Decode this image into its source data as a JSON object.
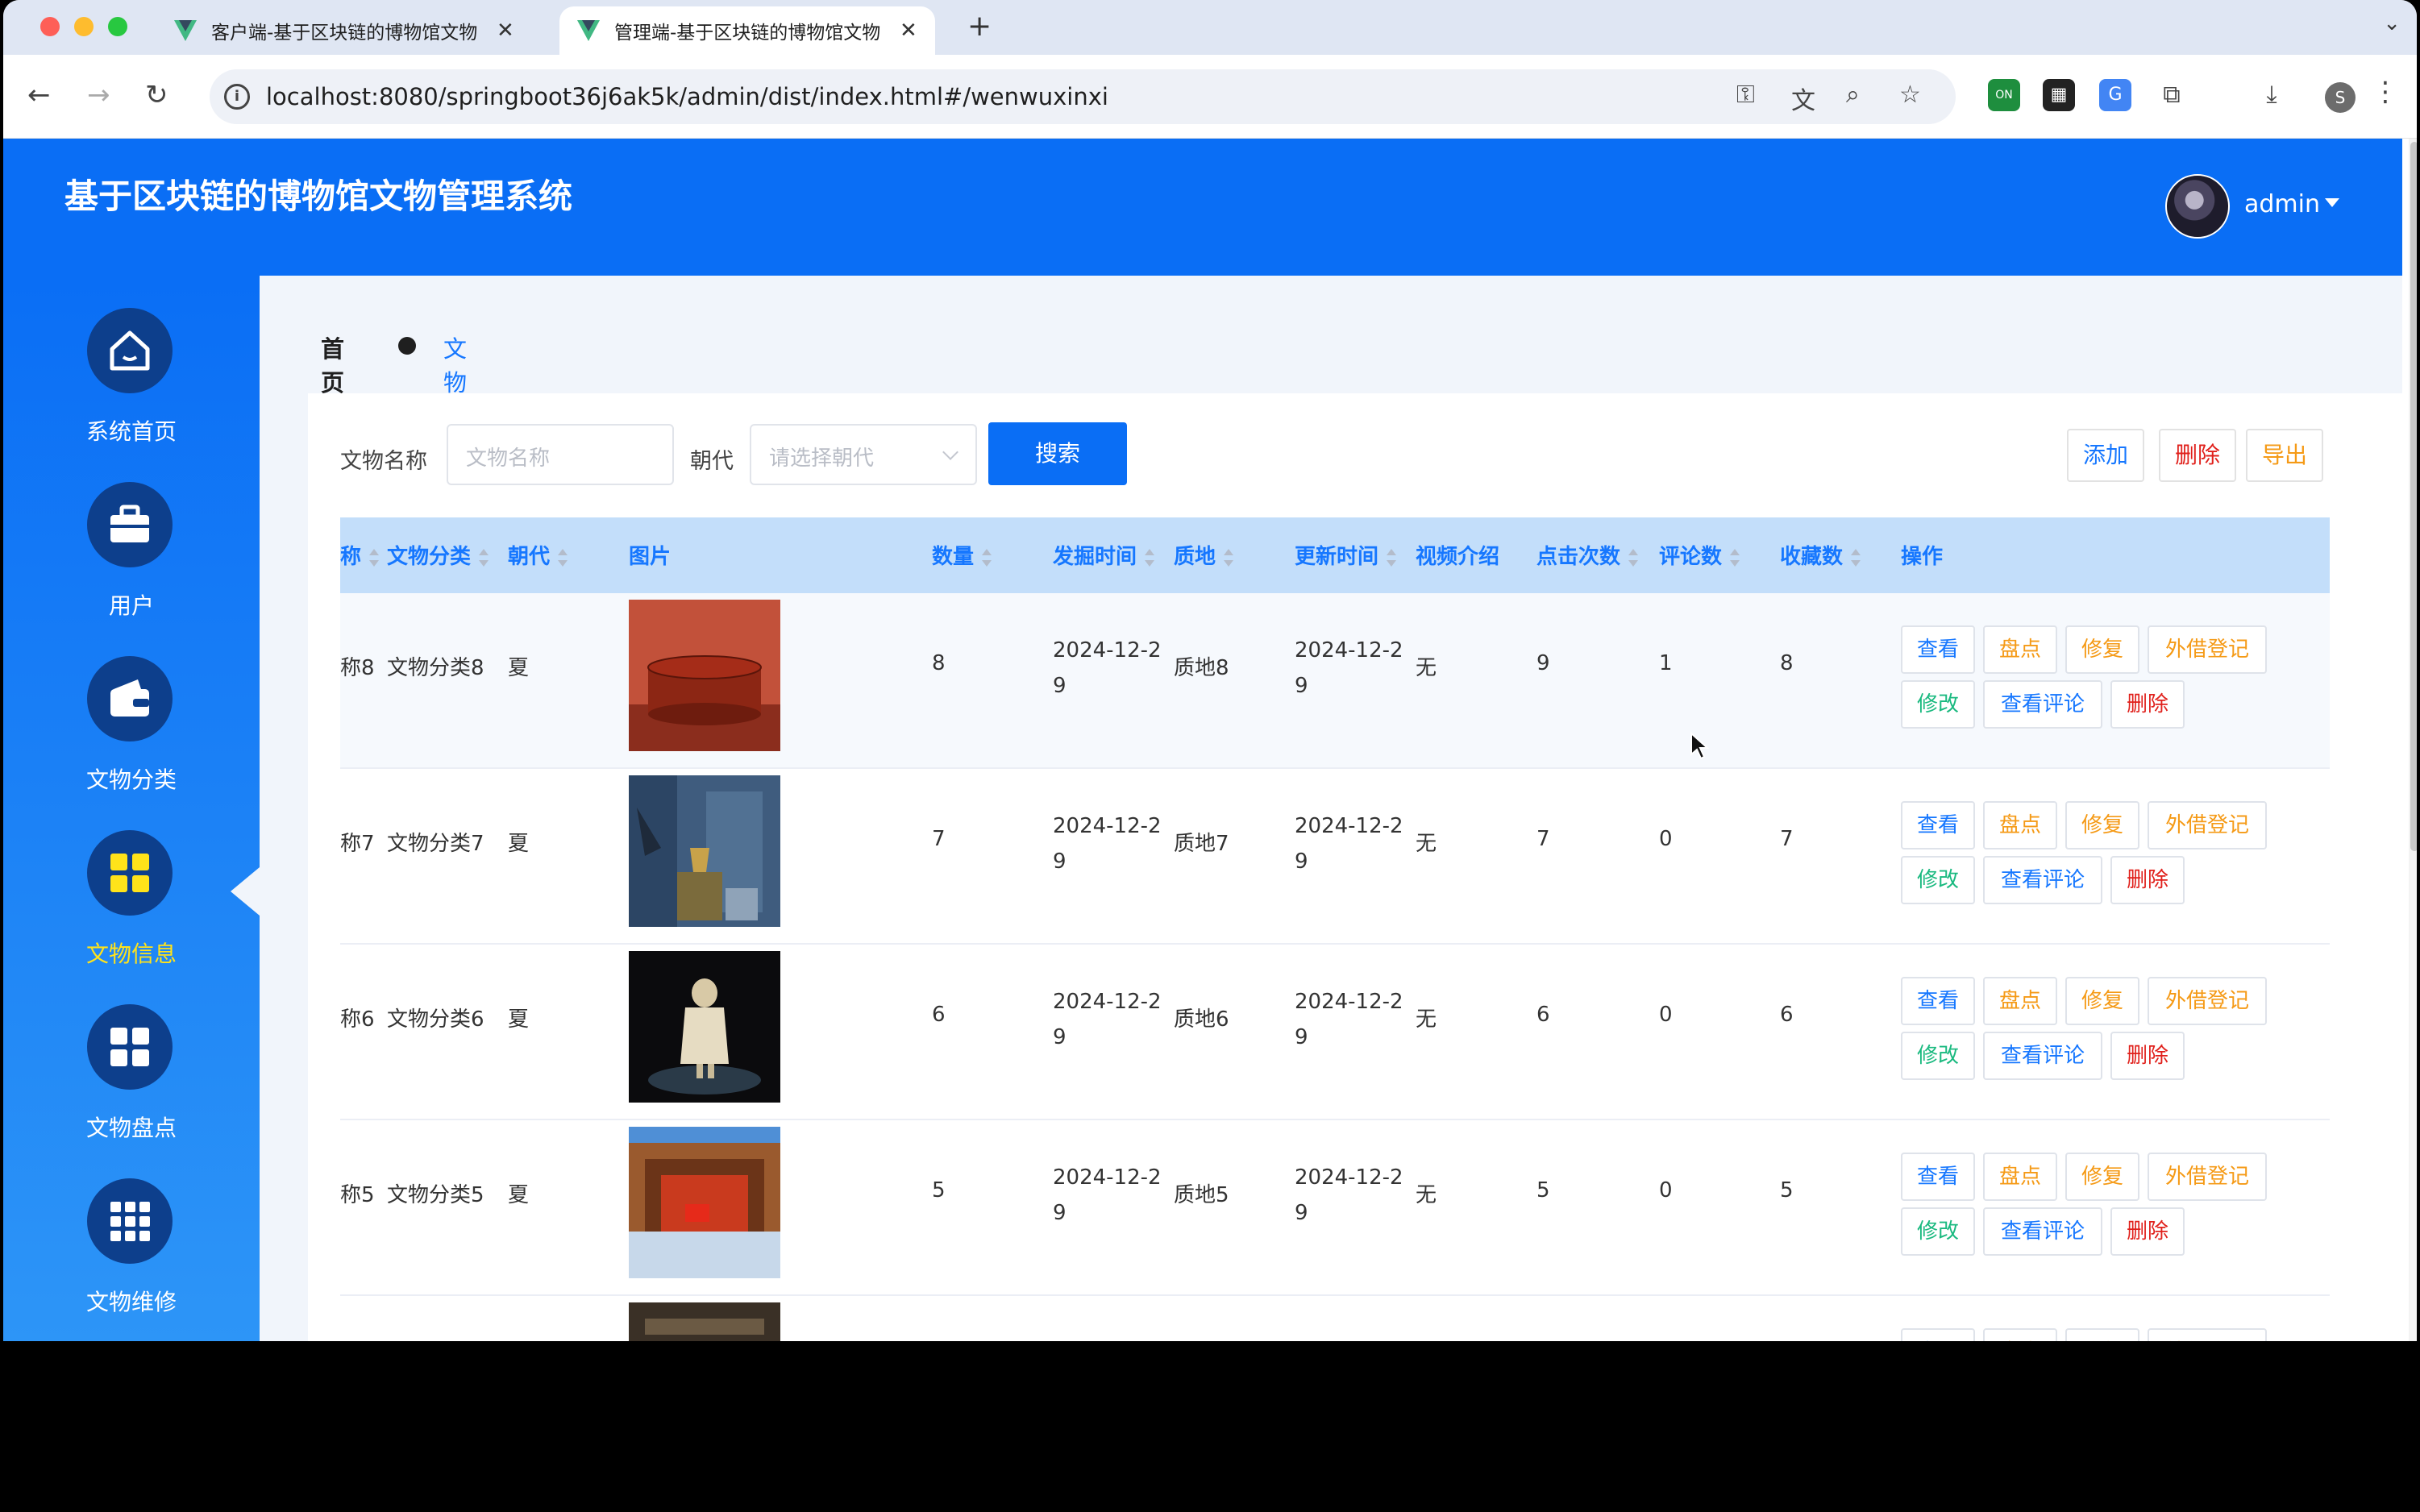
{
  "browser": {
    "tabs": [
      {
        "title": "客户端-基于区块链的博物馆文物",
        "active": false
      },
      {
        "title": "管理端-基于区块链的博物馆文物",
        "active": true
      }
    ],
    "url": "localhost:8080/springboot36j6ak5k/admin/dist/index.html#/wenwuxinxi",
    "profile_initial": "S",
    "extension_badge": "ON"
  },
  "app": {
    "title": "基于区块链的博物馆文物管理系统",
    "user": "admin"
  },
  "sidebar": {
    "items": [
      {
        "label": "系统首页",
        "icon": "home-icon"
      },
      {
        "label": "用户",
        "icon": "briefcase-icon"
      },
      {
        "label": "文物分类",
        "icon": "wallet-icon"
      },
      {
        "label": "文物信息",
        "icon": "grid-four-icon",
        "active": true
      },
      {
        "label": "文物盘点",
        "icon": "grid-four-icon"
      },
      {
        "label": "文物维修",
        "icon": "grid-nine-icon"
      }
    ]
  },
  "breadcrumb": {
    "home": "首页",
    "current": "文物信息"
  },
  "search": {
    "name_label": "文物名称",
    "name_placeholder": "文物名称",
    "dynasty_label": "朝代",
    "dynasty_placeholder": "请选择朝代",
    "search_button": "搜索"
  },
  "actions": {
    "add": "添加",
    "delete": "删除",
    "export": "导出"
  },
  "table": {
    "headers": [
      "称",
      "文物分类",
      "朝代",
      "图片",
      "数量",
      "发掘时间",
      "质地",
      "更新时间",
      "视频介绍",
      "点击次数",
      "评论数",
      "收藏数",
      "操作"
    ],
    "row_buttons": {
      "view": "查看",
      "inventory": "盘点",
      "repair": "修复",
      "loan": "外借登记",
      "edit": "修改",
      "comments": "查看评论",
      "delete": "删除"
    },
    "rows": [
      {
        "name": "称8",
        "category": "文物分类8",
        "dynasty": "夏",
        "qty": "8",
        "dig_a": "2024-12-2",
        "dig_b": "9",
        "texture": "质地8",
        "upd_a": "2024-12-2",
        "upd_b": "9",
        "video": "无",
        "clicks": "9",
        "comments": "1",
        "favs": "8"
      },
      {
        "name": "称7",
        "category": "文物分类7",
        "dynasty": "夏",
        "qty": "7",
        "dig_a": "2024-12-2",
        "dig_b": "9",
        "texture": "质地7",
        "upd_a": "2024-12-2",
        "upd_b": "9",
        "video": "无",
        "clicks": "7",
        "comments": "0",
        "favs": "7"
      },
      {
        "name": "称6",
        "category": "文物分类6",
        "dynasty": "夏",
        "qty": "6",
        "dig_a": "2024-12-2",
        "dig_b": "9",
        "texture": "质地6",
        "upd_a": "2024-12-2",
        "upd_b": "9",
        "video": "无",
        "clicks": "6",
        "comments": "0",
        "favs": "6"
      },
      {
        "name": "称5",
        "category": "文物分类5",
        "dynasty": "夏",
        "qty": "5",
        "dig_a": "2024-12-2",
        "dig_b": "9",
        "texture": "质地5",
        "upd_a": "2024-12-2",
        "upd_b": "9",
        "video": "无",
        "clicks": "5",
        "comments": "0",
        "favs": "5"
      }
    ]
  },
  "colors": {
    "primary": "#0a6ef5",
    "header_row": "#c3defa",
    "active_menu": "#ffe31a"
  }
}
